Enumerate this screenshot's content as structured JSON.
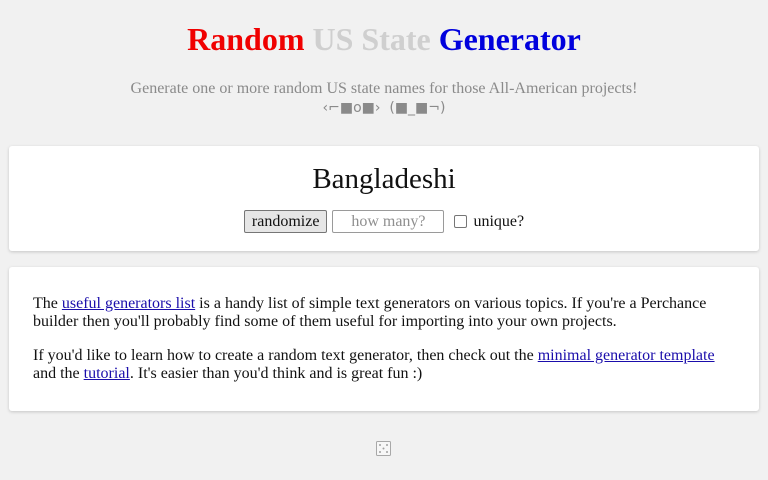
{
  "header": {
    "title_word1": "Random",
    "title_word2": "US State",
    "title_word3": "Generator",
    "subtitle": "Generate one or more random US state names for those All-American projects!",
    "emoticon": "‹⌐■o■› ​​ (■_■¬)"
  },
  "generator": {
    "output": "Bangladeshi",
    "randomize_label": "randomize",
    "count_placeholder": "how many?",
    "count_value": "",
    "unique_label": "unique?",
    "unique_checked": false
  },
  "info": {
    "p1_before": "The",
    "p1_link": "useful generators list",
    "p1_after": "is a handy list of simple text generators on various topics. If you're a Perchance builder then you'll probably find some of them useful for importing into your own projects.",
    "p2_before": "If you'd like to learn how to create a random text generator, then check out the",
    "p2_link1": "minimal generator template",
    "p2_middle": "and the",
    "p2_link2": "tutorial",
    "p2_after": ". It's easier than you'd think and is great fun :)"
  },
  "footer": {
    "icon": "dice-icon"
  },
  "colors": {
    "title_red": "#f00000",
    "title_gray": "#cfcfcf",
    "title_blue": "#0000dd",
    "link": "#1a0dab"
  }
}
